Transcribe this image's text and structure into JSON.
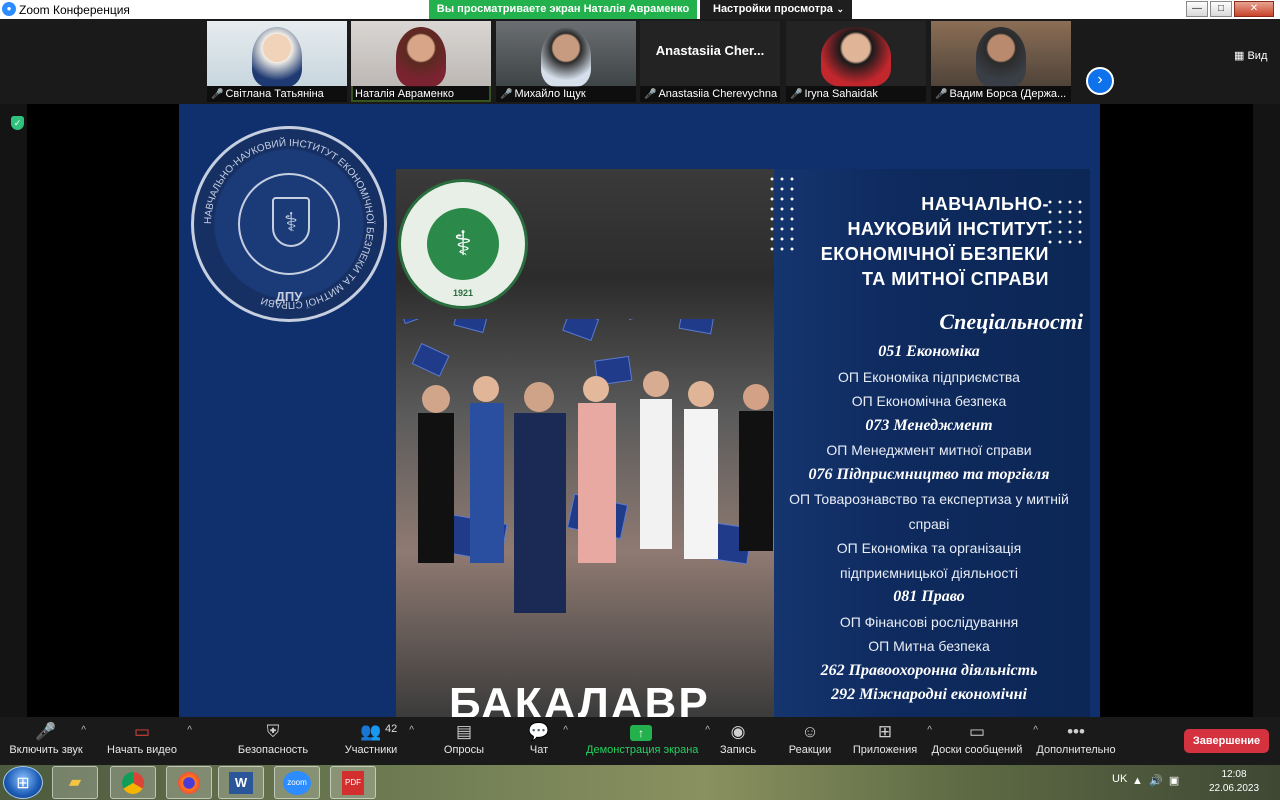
{
  "window": {
    "title": "Zoom Конференция",
    "logo_text": "zoom",
    "share_banner": "Вы просматриваете экран Наталія Авраменко",
    "view_options": "Настройки просмотра",
    "controls": {
      "minimize": "—",
      "maximize": "□",
      "close": "✕"
    }
  },
  "participants": [
    {
      "name": "Світлана Татьяніна",
      "muted": true,
      "has_video": true
    },
    {
      "name": "Наталія Авраменко",
      "muted": false,
      "has_video": true,
      "active": true
    },
    {
      "name": "Михайло Іщук",
      "muted": true,
      "has_video": true
    },
    {
      "name": "Anastasiia Cherevychna",
      "display": "Anastasiia  Cher...",
      "muted": true,
      "has_video": false
    },
    {
      "name": "Iryna Sahaidak",
      "muted": true,
      "has_video": true
    },
    {
      "name": "Вадим Борса (Держа...",
      "muted": true,
      "has_video": true
    }
  ],
  "view_button": "Вид",
  "slide": {
    "seal_text": "НАВЧАЛЬНО-НАУКОВИЙ ІНСТИТУТ ЕКОНОМІЧНОЇ БЕЗПЕКИ ТА МИТНОЇ СПРАВИ",
    "seal_abbr": "ДПУ",
    "mfu_seal_year": "1921",
    "institute_title": [
      "НАВЧАЛЬНО-",
      "НАУКОВИЙ ІНСТИТУТ",
      "ЕКОНОМІЧНОЇ БЕЗПЕКИ",
      "ТА МИТНОЇ СПРАВИ"
    ],
    "specialties_heading": "Спеціальності",
    "specialties": [
      {
        "text": "051 Економіка",
        "heading": true
      },
      {
        "text": "ОП Економіка підприємства",
        "heading": false
      },
      {
        "text": "ОП Економічна безпека",
        "heading": false
      },
      {
        "text": "073 Менеджмент",
        "heading": true
      },
      {
        "text": "ОП Менеджмент митної справи",
        "heading": false
      },
      {
        "text": "076 Підприємництво та торгівля",
        "heading": true
      },
      {
        "text": "ОП Товарознавство та експертиза у митній",
        "heading": false
      },
      {
        "text": "справі",
        "heading": false
      },
      {
        "text": "ОП Економіка та організація",
        "heading": false
      },
      {
        "text": "підприємницької діяльності",
        "heading": false
      },
      {
        "text": "081 Право",
        "heading": true
      },
      {
        "text": "ОП Фінансові рослідування",
        "heading": false
      },
      {
        "text": "ОП Митна безпека",
        "heading": false
      },
      {
        "text": "262 Правоохоронна діяльність",
        "heading": true
      },
      {
        "text": "292 Міжнародні економічні",
        "heading": true
      }
    ],
    "bottom_title": "БАКАЛАВР"
  },
  "toolbar": {
    "audio": "Включить звук",
    "video": "Начать видео",
    "security": "Безопасность",
    "participants": "Участники",
    "participants_count": "42",
    "polls": "Опросы",
    "chat": "Чат",
    "share": "Демонстрация экрана",
    "record": "Запись",
    "reactions": "Реакции",
    "apps": "Приложения",
    "whiteboards": "Доски сообщений",
    "more": "Дополнительно",
    "end": "Завершение"
  },
  "taskbar": {
    "apps": [
      "explorer",
      "chrome",
      "firefox",
      "word",
      "zoom",
      "pdf"
    ],
    "word_label": "W",
    "zoom_label": "zoom",
    "pdf_label": "PDF",
    "language": "UK",
    "time": "12:08",
    "date": "22.06.2023"
  },
  "colors": {
    "slide_bg": "#102f6d",
    "share_green": "#23b14d",
    "end_red": "#d5323f",
    "zoom_blue": "#0e72ed"
  }
}
